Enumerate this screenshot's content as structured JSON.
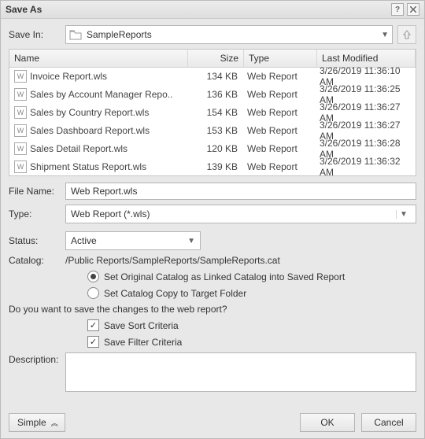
{
  "title": "Save As",
  "save_in_label": "Save In:",
  "save_in_value": "SampleReports",
  "table": {
    "headers": {
      "name": "Name",
      "size": "Size",
      "type": "Type",
      "date": "Last Modified"
    },
    "rows": [
      {
        "name": "Invoice Report.wls",
        "size": "134 KB",
        "type": "Web Report",
        "date": "3/26/2019 11:36:10 AM"
      },
      {
        "name": "Sales by Account Manager Repo..",
        "size": "136 KB",
        "type": "Web Report",
        "date": "3/26/2019 11:36:25 AM"
      },
      {
        "name": "Sales by Country Report.wls",
        "size": "154 KB",
        "type": "Web Report",
        "date": "3/26/2019 11:36:27 AM"
      },
      {
        "name": "Sales Dashboard Report.wls",
        "size": "153 KB",
        "type": "Web Report",
        "date": "3/26/2019 11:36:27 AM"
      },
      {
        "name": "Sales Detail Report.wls",
        "size": "120 KB",
        "type": "Web Report",
        "date": "3/26/2019 11:36:28 AM"
      },
      {
        "name": "Shipment Status Report.wls",
        "size": "139 KB",
        "type": "Web Report",
        "date": "3/26/2019 11:36:32 AM"
      }
    ]
  },
  "file_name_label": "File Name:",
  "file_name_value": "Web Report.wls",
  "type_label": "Type:",
  "type_value": "Web Report (*.wls)",
  "status_label": "Status:",
  "status_value": "Active",
  "catalog_label": "Catalog:",
  "catalog_value": "/Public Reports/SampleReports/SampleReports.cat",
  "radio": {
    "linked": "Set Original Catalog as Linked Catalog into Saved Report",
    "copy": "Set Catalog Copy to Target Folder"
  },
  "prompt": "Do you want to save the changes to the web report?",
  "check": {
    "sort": "Save Sort Criteria",
    "filter": "Save Filter Criteria"
  },
  "description_label": "Description:",
  "description_value": "",
  "buttons": {
    "simple": "Simple",
    "ok": "OK",
    "cancel": "Cancel"
  }
}
